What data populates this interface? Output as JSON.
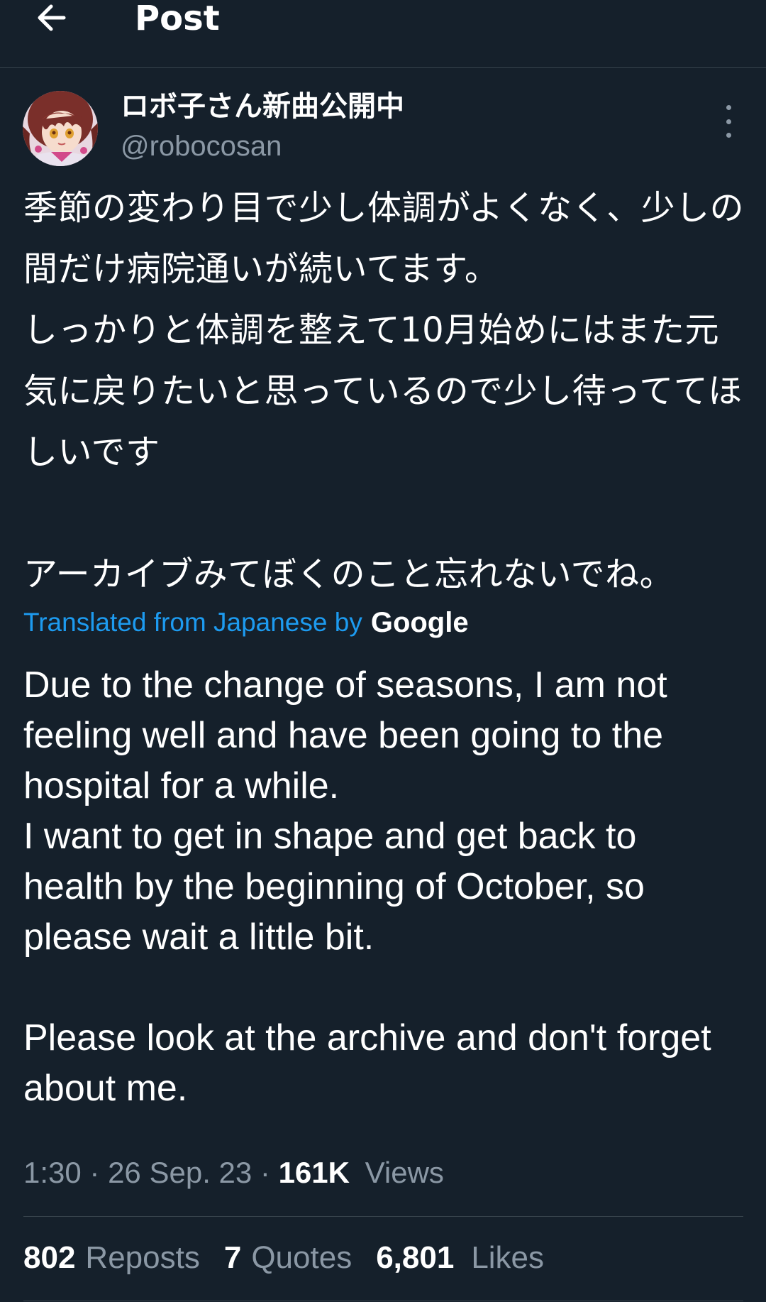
{
  "header": {
    "title": "Post"
  },
  "author": {
    "display_name": "ロボ子さん新曲公開中",
    "handle": "@robocosan"
  },
  "post": {
    "original_text": "季節の変わり目で少し体調がよくなく、少しの間だけ病院通いが続いてます。\nしっかりと体調を整えて10月始めにはまた元気に戻りたいと思っているので少し待っててほしいです\n\nアーカイブみてぼくのこと忘れないでね。",
    "translated_label": "Translated from Japanese by",
    "translator": "Google",
    "translated_text": "Due to the change of seasons, I am not feeling well and have been going to the hospital for a while.\nI want to get in shape and get back to health by the beginning of October, so please wait a little bit.\n\nPlease look at the archive and don't forget about me."
  },
  "meta": {
    "time": "1:30",
    "separator": "·",
    "date": "26 Sep. 23",
    "views_count": "161K",
    "views_label": "Views"
  },
  "stats": {
    "reposts_count": "802",
    "reposts_label": "Reposts",
    "quotes_count": "7",
    "quotes_label": "Quotes",
    "likes_count": "6,801",
    "likes_label": "Likes"
  },
  "icons": {
    "back": "arrow-left-icon",
    "more": "more-vertical-icon",
    "avatar": "avatar-image"
  },
  "colors": {
    "background": "#15202b",
    "link": "#1d9bf0",
    "secondary_text": "#8b98a5",
    "divider": "#38444d"
  }
}
